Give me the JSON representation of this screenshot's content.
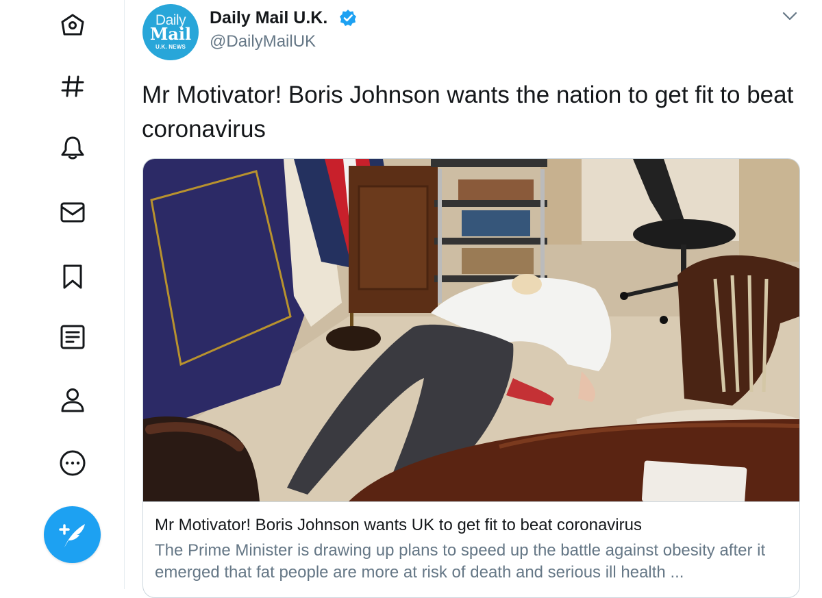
{
  "sidebar": {
    "items": [
      {
        "icon": "home-icon"
      },
      {
        "icon": "explore-hashtag-icon"
      },
      {
        "icon": "notifications-bell-icon"
      },
      {
        "icon": "messages-envelope-icon"
      },
      {
        "icon": "bookmarks-icon"
      },
      {
        "icon": "lists-icon"
      },
      {
        "icon": "profile-icon"
      },
      {
        "icon": "more-icon"
      }
    ],
    "compose_icon": "compose-tweet-icon",
    "accent_color": "#1da1f2"
  },
  "tweet": {
    "author_name": "Daily Mail U.K.",
    "handle": "@DailyMailUK",
    "verified": true,
    "avatar": {
      "line1": "Daily",
      "line2": "Mail",
      "line3": "U.K. NEWS"
    },
    "text": "Mr Motivator! Boris Johnson wants the nation to get fit to beat coronavirus",
    "card": {
      "title": "Mr Motivator! Boris Johnson wants UK to get fit to beat coronavirus",
      "description": "The Prime Minister is drawing up plans to speed up the battle against obesity after it emerged that fat people are more at risk of death and serious ill health ..."
    }
  }
}
